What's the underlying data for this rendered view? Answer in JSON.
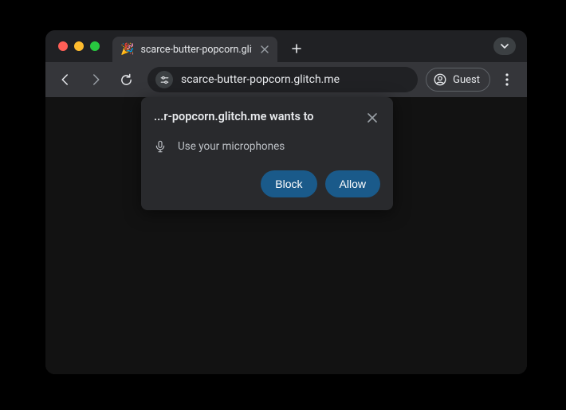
{
  "tab": {
    "favicon": "🎉",
    "title": "scarce-butter-popcorn.glitch"
  },
  "omnibox": {
    "url": "scarce-butter-popcorn.glitch.me"
  },
  "profile": {
    "label": "Guest"
  },
  "permission_prompt": {
    "title": "...r-popcorn.glitch.me wants to",
    "request": "Use your microphones",
    "block_label": "Block",
    "allow_label": "Allow"
  }
}
